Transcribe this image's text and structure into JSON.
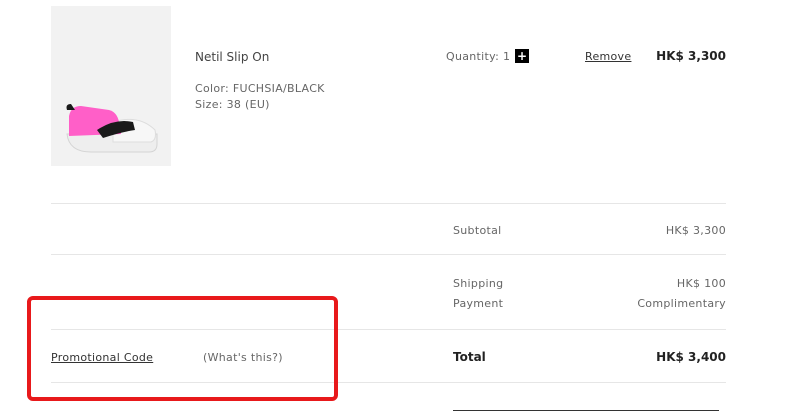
{
  "colors": {
    "accent_annotation": "#e8191b",
    "product_pink": "#ff5fc8",
    "divider": "#e6e6e6"
  },
  "product": {
    "name": "Netil Slip On",
    "color_label": "Color:",
    "color_value": "FUCHSIA/BLACK",
    "size_label": "Size:",
    "size_value": "38  (EU)",
    "quantity_label": "Quantity:",
    "quantity_value": "1",
    "plus_icon": "plus-icon",
    "remove_label": "Remove",
    "price": "HK$ 3,300"
  },
  "summary": {
    "subtotal_label": "Subtotal",
    "subtotal_value": "HK$ 3,300",
    "shipping_label": "Shipping",
    "shipping_value": "HK$ 100",
    "payment_label": "Payment",
    "payment_value": "Complimentary",
    "total_label": "Total",
    "total_value": "HK$ 3,400"
  },
  "promo": {
    "code_label": "Promotional Code",
    "whats_this": "(What's this?)"
  }
}
